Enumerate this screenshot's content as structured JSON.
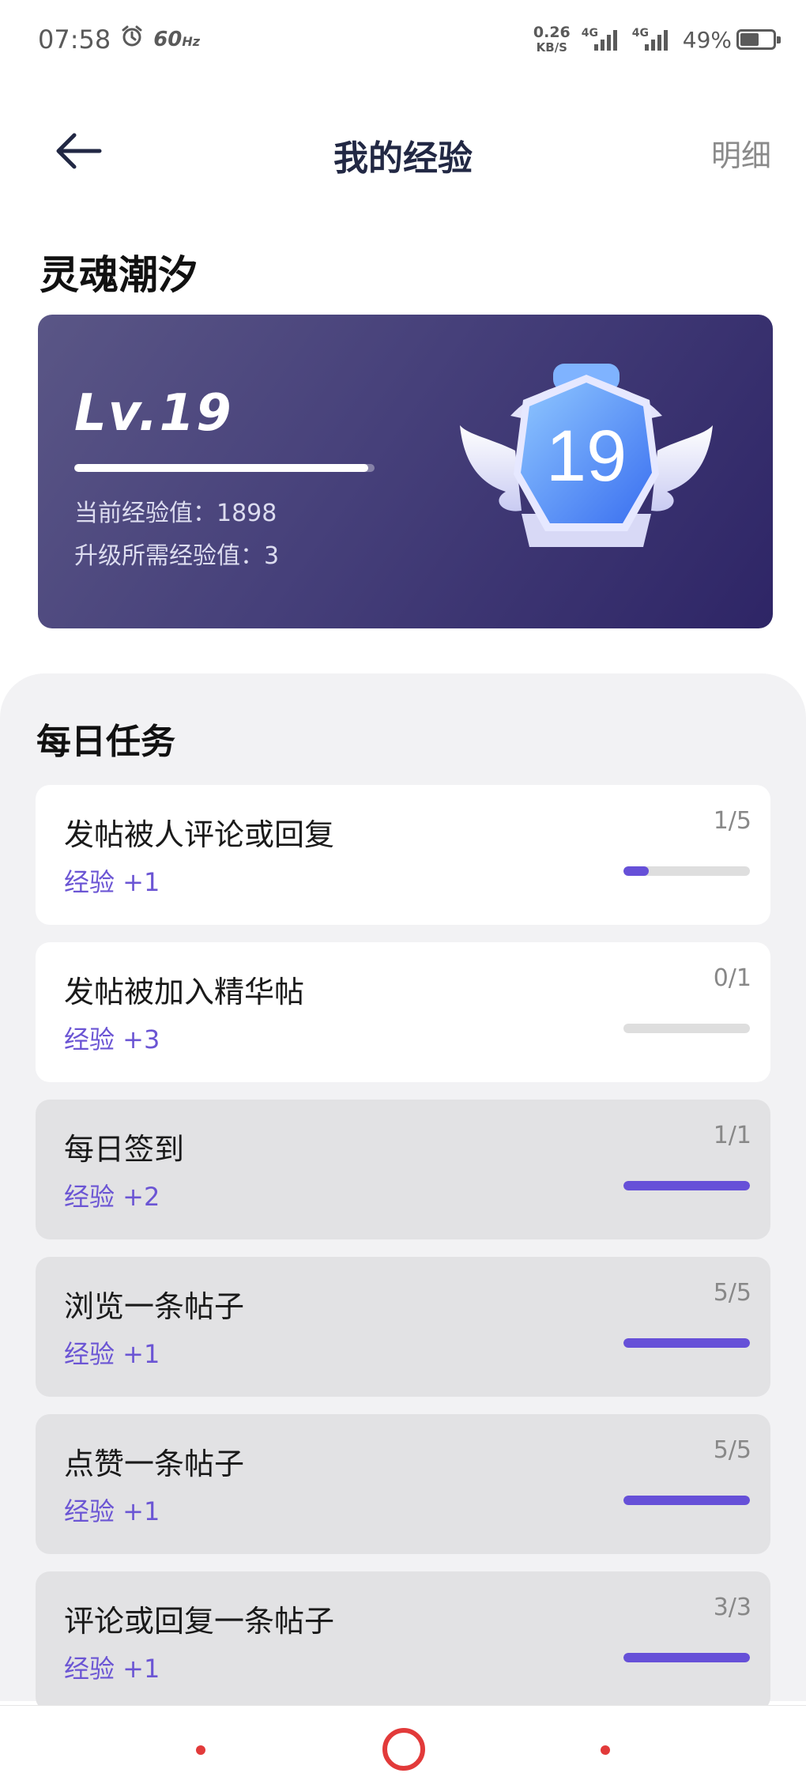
{
  "status_bar": {
    "time": "07:58",
    "refresh_rate": "60",
    "refresh_unit": "Hz",
    "net_speed": "0.26",
    "net_unit": "KB/S",
    "signal1_label": "4G",
    "signal2_label": "4G",
    "battery": "49%",
    "battery_level": 0.49
  },
  "header": {
    "title": "我的经验",
    "detail_label": "明细"
  },
  "user": {
    "name": "灵魂潮汐"
  },
  "level": {
    "label": "Lv.19",
    "number": "19",
    "current_exp": "当前经验值：1898",
    "needed_exp": "升级所需经验值：3",
    "progress": 0.98
  },
  "daily_tasks": {
    "title": "每日任务",
    "items": [
      {
        "name": "发帖被人评论或回复",
        "reward": "经验 +1",
        "count": "1/5",
        "progress": 0.2,
        "done": false
      },
      {
        "name": "发帖被加入精华帖",
        "reward": "经验 +3",
        "count": "0/1",
        "progress": 0.0,
        "done": false
      },
      {
        "name": "每日签到",
        "reward": "经验 +2",
        "count": "1/1",
        "progress": 1.0,
        "done": true
      },
      {
        "name": "浏览一条帖子",
        "reward": "经验 +1",
        "count": "5/5",
        "progress": 1.0,
        "done": true
      },
      {
        "name": "点赞一条帖子",
        "reward": "经验 +1",
        "count": "5/5",
        "progress": 1.0,
        "done": true
      },
      {
        "name": "评论或回复一条帖子",
        "reward": "经验 +1",
        "count": "3/3",
        "progress": 1.0,
        "done": true
      }
    ]
  },
  "colors": {
    "accent": "#6650d8",
    "card_gradient_start": "#5a5686",
    "card_gradient_end": "#2e2566",
    "nav_accent": "#e23a3a"
  },
  "icons": {
    "back": "arrow-left-icon",
    "alarm": "alarm-clock-icon",
    "badge": "winged-shield-badge-icon",
    "nav_home": "circle-home-icon"
  }
}
